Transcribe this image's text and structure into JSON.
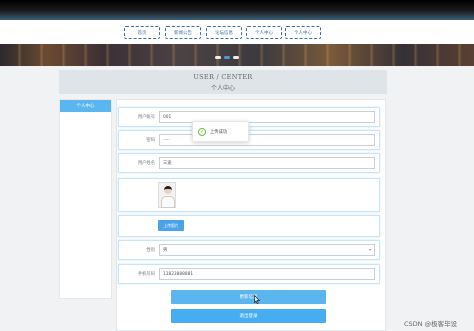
{
  "nav": {
    "items": [
      "首页",
      "新闻公告",
      "论坛信息",
      "个人中心",
      "个人中心"
    ]
  },
  "banner": {
    "dots": 3,
    "active_dot": 1
  },
  "center": {
    "title_en": "USER / CENTER",
    "title_cn": "个人中心"
  },
  "sidebar": {
    "items": [
      {
        "label": "个人中心",
        "active": true
      }
    ]
  },
  "form": {
    "account": {
      "label": "用户账号",
      "value": "001"
    },
    "password": {
      "label": "密码",
      "value": "·····"
    },
    "name": {
      "label": "用户姓名",
      "value": "三迪"
    },
    "upload_label": "上传图片",
    "gender": {
      "label": "性别",
      "value": "男"
    },
    "phone": {
      "label": "手机号码",
      "value": "13823888881"
    }
  },
  "buttons": {
    "update": "更新信息",
    "logout": "退出登录"
  },
  "toast": {
    "message": "上传成功",
    "icon": "check-circle-icon"
  },
  "watermark": "CSDN @极客毕设",
  "colors": {
    "accent": "#4aa3e8",
    "success": "#67c23a",
    "nav_border": "#3b6ea3"
  }
}
